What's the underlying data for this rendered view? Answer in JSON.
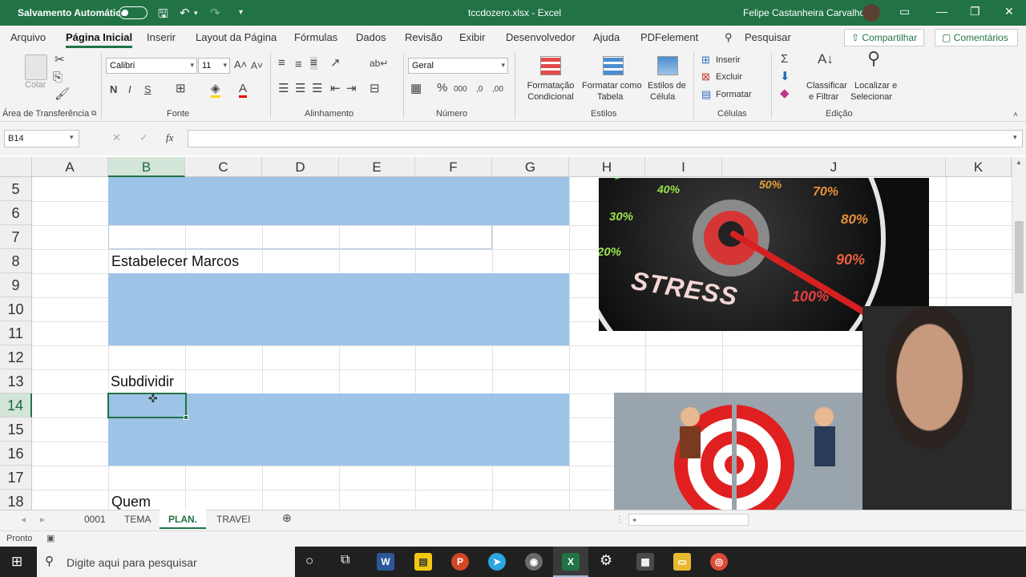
{
  "titlebar": {
    "autosave_label": "Salvamento Automático",
    "filename": "tccdozero.xlsx  -  Excel",
    "user": "Felipe Castanheira Carvalho"
  },
  "tabs": [
    "Arquivo",
    "Página Inicial",
    "Inserir",
    "Layout da Página",
    "Fórmulas",
    "Dados",
    "Revisão",
    "Exibir",
    "Desenvolvedor",
    "Ajuda",
    "PDFelement"
  ],
  "search": {
    "label": "Pesquisar"
  },
  "share": {
    "share_label": "Compartilhar",
    "comments_label": "Comentários"
  },
  "ribbon": {
    "clipboard": {
      "paste": "Colar",
      "group": "Área de Transferência"
    },
    "font": {
      "name": "Calibri",
      "size": "11",
      "bold": "N",
      "italic": "I",
      "underline": "S",
      "group": "Fonte"
    },
    "alignment": {
      "group": "Alinhamento"
    },
    "number": {
      "format": "Geral",
      "group": "Número"
    },
    "styles": {
      "cond_1": "Formatação",
      "cond_2": "Condicional",
      "table_1": "Formatar como",
      "table_2": "Tabela",
      "cell_1": "Estilos de",
      "cell_2": "Célula",
      "group": "Estilos"
    },
    "cells": {
      "insert": "Inserir",
      "delete": "Excluir",
      "format": "Formatar",
      "group": "Células"
    },
    "editing": {
      "sort_1": "Classificar",
      "sort_2": "e Filtrar",
      "find_1": "Localizar e",
      "find_2": "Selecionar",
      "group": "Edição"
    }
  },
  "formula_bar": {
    "name_box": "B14",
    "fx": "fx",
    "value": ""
  },
  "columns": [
    "A",
    "B",
    "C",
    "D",
    "E",
    "F",
    "G",
    "H",
    "I",
    "J",
    "K"
  ],
  "rows": [
    "5",
    "6",
    "7",
    "8",
    "9",
    "10",
    "11",
    "12",
    "13",
    "14",
    "15",
    "16",
    "17",
    "18"
  ],
  "cells": {
    "B8": "Estabelecer Marcos",
    "B13": "Subdividir",
    "B18": "Quem"
  },
  "selected_cell": "B14",
  "images": {
    "stress_gauge": {
      "word": "STRESS",
      "labels": [
        "40%",
        "50%",
        "70%",
        "30%",
        "80%",
        "20%",
        "90%",
        "100%"
      ]
    }
  },
  "sheets": [
    {
      "name": "0001",
      "active": false
    },
    {
      "name": "TEMA",
      "active": false
    },
    {
      "name": "PLAN.",
      "active": true
    },
    {
      "name": "TRAVEI",
      "active": false
    }
  ],
  "status": {
    "ready": "Pronto"
  },
  "taskbar": {
    "search_placeholder": "Digite aqui para pesquisar"
  },
  "colors": {
    "excel_green": "#217346",
    "cell_fill": "#9dc3e6"
  }
}
